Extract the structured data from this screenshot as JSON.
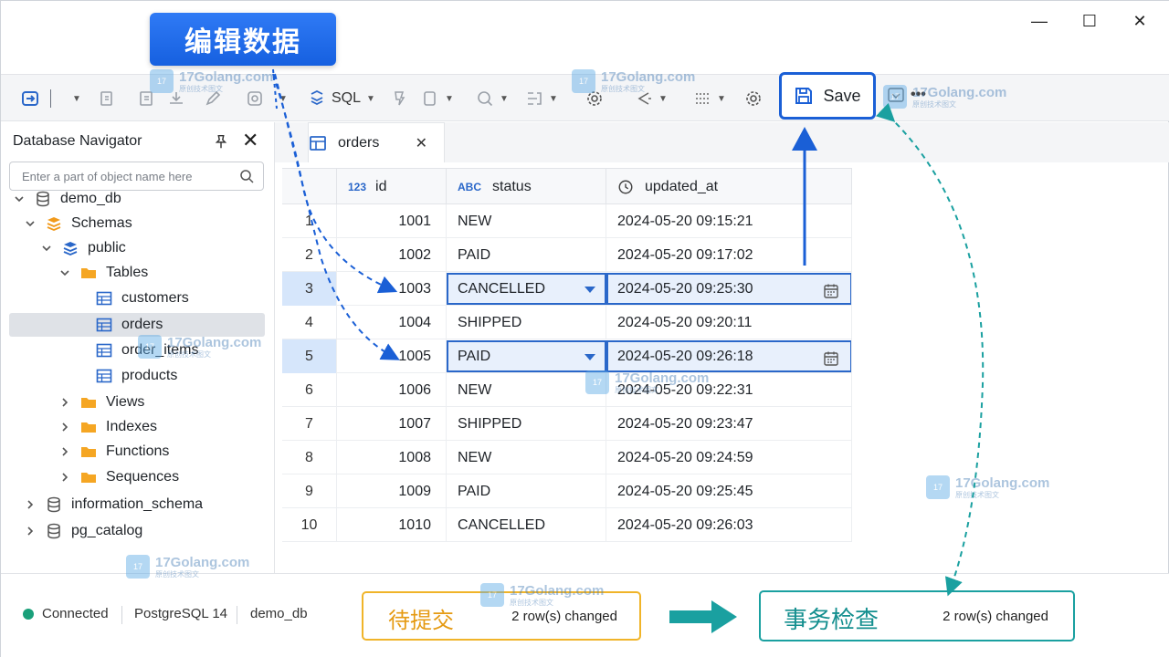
{
  "window": {
    "minimize_glyph": "—",
    "maximize_glyph": "☐",
    "close_glyph": "✕"
  },
  "callouts": {
    "edit_data": "编辑数据",
    "pending": {
      "title": "待提交",
      "count": "2 row(s) changed"
    },
    "transaction": {
      "title": "事务检查",
      "count": "2 row(s) changed"
    }
  },
  "toolbar": {
    "sql_label": "SQL",
    "save_label": "Save"
  },
  "navigator": {
    "title": "Database Navigator",
    "close_glyph": "✕",
    "search_placeholder": "Enter a part of object name here",
    "tree": [
      {
        "label": "demo_db",
        "level": 0,
        "expanded": true,
        "icon": "database-icon"
      },
      {
        "label": "Schemas",
        "level": 1,
        "expanded": true,
        "icon": "schemas-icon"
      },
      {
        "label": "public",
        "level": 2,
        "expanded": true,
        "icon": "schema-icon"
      },
      {
        "label": "Tables",
        "level": 3,
        "expanded": true,
        "icon": "folder-icon"
      },
      {
        "label": "customers",
        "level": 4,
        "icon": "table-icon"
      },
      {
        "label": "orders",
        "level": 4,
        "icon": "table-icon",
        "selected": true
      },
      {
        "label": "order_items",
        "level": 4,
        "icon": "table-icon"
      },
      {
        "label": "products",
        "level": 4,
        "icon": "table-icon"
      },
      {
        "label": "Views",
        "level": 3,
        "expanded": false,
        "icon": "folder-icon"
      },
      {
        "label": "Indexes",
        "level": 3,
        "expanded": false,
        "icon": "folder-icon"
      },
      {
        "label": "Functions",
        "level": 3,
        "expanded": false,
        "icon": "folder-icon"
      },
      {
        "label": "Sequences",
        "level": 3,
        "expanded": false,
        "icon": "folder-icon"
      },
      {
        "label": "information_schema",
        "level": 1,
        "expanded": false,
        "icon": "database-icon"
      },
      {
        "label": "pg_catalog",
        "level": 1,
        "expanded": false,
        "icon": "database-icon"
      }
    ]
  },
  "tab": {
    "label": "orders",
    "close_glyph": "✕"
  },
  "grid": {
    "columns": [
      {
        "label": "id",
        "type_badge": "123"
      },
      {
        "label": "status",
        "type_badge": "ABC"
      },
      {
        "label": "updated_at",
        "type_badge": "clock"
      }
    ],
    "rows": [
      {
        "num": "1",
        "id": "1001",
        "status": "NEW",
        "updated_at": "2024-05-20 09:15:21"
      },
      {
        "num": "2",
        "id": "1002",
        "status": "PAID",
        "updated_at": "2024-05-20 09:17:02"
      },
      {
        "num": "3",
        "id": "1003",
        "status": "CANCELLED",
        "updated_at": "2024-05-20 09:25:30",
        "edited": true
      },
      {
        "num": "4",
        "id": "1004",
        "status": "SHIPPED",
        "updated_at": "2024-05-20 09:20:11"
      },
      {
        "num": "5",
        "id": "1005",
        "status": "PAID",
        "updated_at": "2024-05-20 09:26:18",
        "edited": true
      },
      {
        "num": "6",
        "id": "1006",
        "status": "NEW",
        "updated_at": "2024-05-20 09:22:31"
      },
      {
        "num": "7",
        "id": "1007",
        "status": "SHIPPED",
        "updated_at": "2024-05-20 09:23:47"
      },
      {
        "num": "8",
        "id": "1008",
        "status": "NEW",
        "updated_at": "2024-05-20 09:24:59"
      },
      {
        "num": "9",
        "id": "1009",
        "status": "PAID",
        "updated_at": "2024-05-20 09:25:45"
      },
      {
        "num": "10",
        "id": "1010",
        "status": "CANCELLED",
        "updated_at": "2024-05-20 09:26:03"
      }
    ]
  },
  "statusbar": {
    "connection": "Connected",
    "db_engine": "PostgreSQL 14",
    "database": "demo_db"
  },
  "watermark": {
    "text": "17Golang.com",
    "sub": "原创技术图文",
    "badge": "17"
  },
  "colors": {
    "accent": "#1a5fd6",
    "pending": "#f0b429",
    "transaction": "#1aa0a0",
    "connected": "#1aa07a"
  }
}
